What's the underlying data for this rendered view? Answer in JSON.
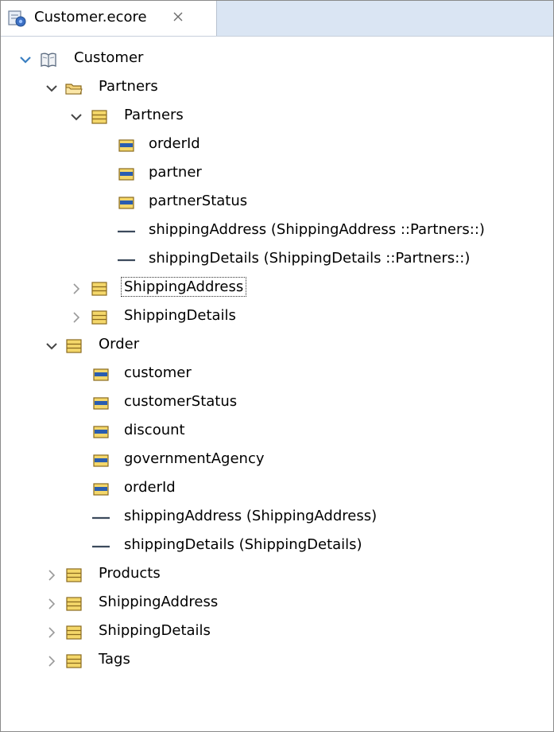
{
  "tab": {
    "title": "Customer.ecore",
    "icon": "ecore-model-icon",
    "close_icon": "close-icon"
  },
  "tree": {
    "root": {
      "label": "Customer",
      "icon": "package-book-icon",
      "expanded": true
    },
    "partners_pkg": {
      "label": "Partners",
      "icon": "folder-package-icon",
      "expanded": true
    },
    "partners_class": {
      "label": "Partners",
      "icon": "eclass-icon",
      "expanded": true,
      "features": [
        {
          "label": "orderId",
          "icon": "eattribute-icon"
        },
        {
          "label": "partner",
          "icon": "eattribute-icon"
        },
        {
          "label": "partnerStatus",
          "icon": "eattribute-icon"
        },
        {
          "label": "shippingAddress (ShippingAddress ::Partners::)",
          "icon": "ereference-icon"
        },
        {
          "label": "shippingDetails (ShippingDetails ::Partners::)",
          "icon": "ereference-icon"
        }
      ]
    },
    "partners_shipping_address": {
      "label": "ShippingAddress",
      "icon": "eclass-icon",
      "expanded": false,
      "focused": true
    },
    "partners_shipping_details": {
      "label": "ShippingDetails",
      "icon": "eclass-icon",
      "expanded": false
    },
    "order": {
      "label": "Order",
      "icon": "eclass-icon",
      "expanded": true,
      "features": [
        {
          "label": "customer",
          "icon": "eattribute-icon"
        },
        {
          "label": "customerStatus",
          "icon": "eattribute-icon"
        },
        {
          "label": "discount",
          "icon": "eattribute-icon"
        },
        {
          "label": "governmentAgency",
          "icon": "eattribute-icon"
        },
        {
          "label": "orderId",
          "icon": "eattribute-icon"
        },
        {
          "label": "shippingAddress (ShippingAddress)",
          "icon": "ereference-icon"
        },
        {
          "label": "shippingDetails (ShippingDetails)",
          "icon": "ereference-icon"
        }
      ]
    },
    "top_classes": [
      {
        "label": "Products",
        "icon": "eclass-icon",
        "expanded": false
      },
      {
        "label": "ShippingAddress",
        "icon": "eclass-icon",
        "expanded": false
      },
      {
        "label": "ShippingDetails",
        "icon": "eclass-icon",
        "expanded": false
      },
      {
        "label": "Tags",
        "icon": "eclass-icon",
        "expanded": false
      }
    ]
  },
  "colors": {
    "tab_bar": "#dae5f3",
    "expander_open": "#3a7fc1",
    "expander_closed": "#9a9a9a",
    "class_icon_fill": "#f4d76a",
    "attribute_icon_blue": "#2a5db0",
    "reference_line": "#3c4a5c"
  }
}
